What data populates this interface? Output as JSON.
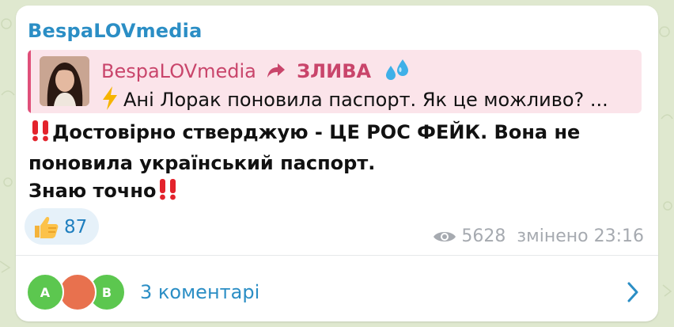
{
  "colors": {
    "background": "#dfe8cf",
    "channel_name": "#2b8ec5",
    "reply_accent": "#e0507a",
    "reply_bg": "#fbe4ea",
    "link": "#2b8ec5",
    "meta": "#a6aab0"
  },
  "message": {
    "channel_name": "BespaLOVmedia",
    "reply": {
      "author": "BespaLOVmedia",
      "forward_icon": "forward-arrow-icon",
      "tag": "ЗЛИВА",
      "tag_icon": "sweat-droplets-icon",
      "text_icon": "high-voltage-icon",
      "text": "Ані Лорак поновила паспорт. Як це можливо? ..."
    },
    "body": {
      "line1": "Достовірно стверджую - ЦЕ РОС ФЕЙК. Вона не",
      "line2": "поновила український паспорт.",
      "line3": "Знаю точно",
      "emphasis_icon": "double-exclamation-icon"
    },
    "reaction": {
      "icon": "thumbs-up-icon",
      "count": "87"
    },
    "meta": {
      "views_icon": "eye-icon",
      "views": "5628",
      "edited": "змінено 23:16"
    },
    "comments": {
      "avatars": [
        "A",
        "",
        "B"
      ],
      "label": "3 коментарі",
      "chevron": "chevron-right-icon"
    }
  }
}
